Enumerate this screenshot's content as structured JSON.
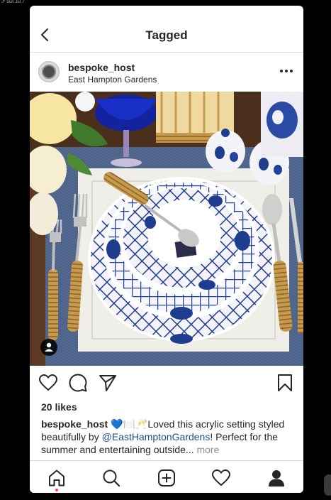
{
  "status_strip": {
    "text": "J⁰ Sun Jul 7"
  },
  "header": {
    "title": "Tagged"
  },
  "post": {
    "username": "bespoke_host",
    "location": "East Hampton Gardens",
    "likes": "20 likes",
    "caption": {
      "user": "bespoke_host",
      "emojis": " 💙🍽️🥂",
      "text_1": "Loved this acrylic setting styled beautifully by ",
      "mention": "@EastHamptonGardens",
      "text_2": "! Perfect for the summer and entertaining outside... ",
      "more": "more"
    }
  },
  "icons": {
    "back": "chevron-left-icon",
    "more": "ellipsis-icon",
    "like": "heart-icon",
    "comment": "comment-bubble-icon",
    "share": "paper-plane-icon",
    "save": "bookmark-icon",
    "tag": "person-tag-icon",
    "nav": [
      "home-icon",
      "search-icon",
      "new-post-icon",
      "activity-heart-icon",
      "profile-icon"
    ]
  },
  "colors": {
    "text": "#262626",
    "divider": "#dbdbdb",
    "mention": "#1c4f8a",
    "muted": "#8e8e8e",
    "notification_dot": "#ed4956",
    "china_blue": "#1f3d8f"
  }
}
